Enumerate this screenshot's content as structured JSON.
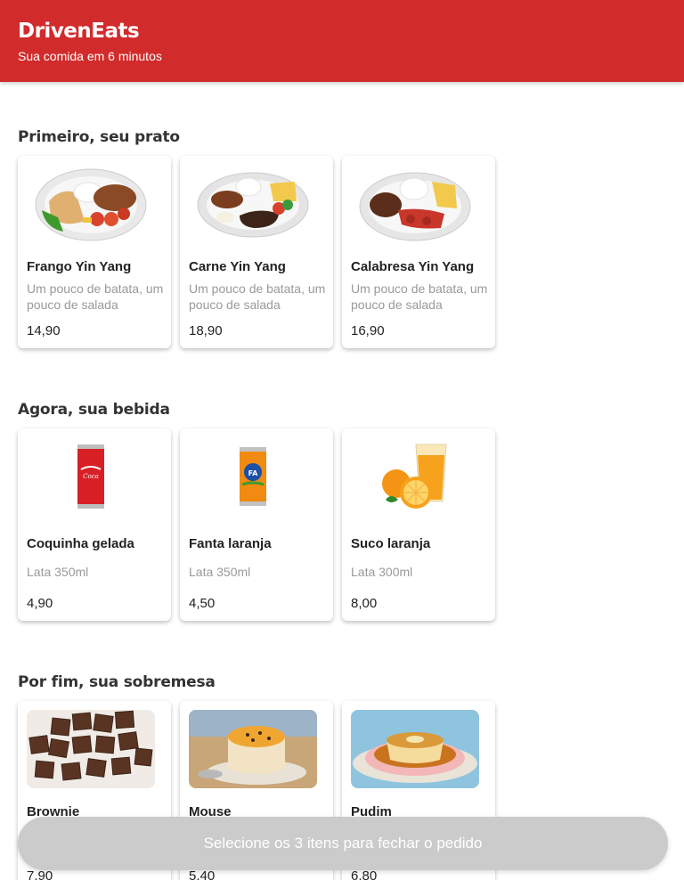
{
  "header": {
    "title": "DrivenEats",
    "subtitle": "Sua comida em 6 minutos"
  },
  "sections": [
    {
      "title": "Primeiro, seu prato",
      "items": [
        {
          "name": "Frango Yin Yang",
          "desc": "Um pouco de batata, um pouco de salada",
          "price": "14,90",
          "image": "chicken-plate-image"
        },
        {
          "name": "Carne Yin Yang",
          "desc": "Um pouco de batata, um pouco de salada",
          "price": "18,90",
          "image": "beef-plate-image"
        },
        {
          "name": "Calabresa Yin Yang",
          "desc": "Um pouco de batata, um pouco de salada",
          "price": "16,90",
          "image": "sausage-plate-image"
        }
      ]
    },
    {
      "title": "Agora, sua bebida",
      "items": [
        {
          "name": "Coquinha gelada",
          "desc": "Lata 350ml",
          "price": "4,90",
          "image": "coca-cola-can-image"
        },
        {
          "name": "Fanta laranja",
          "desc": "Lata 350ml",
          "price": "4,50",
          "image": "fanta-can-image"
        },
        {
          "name": "Suco laranja",
          "desc": "Lata 300ml",
          "price": "8,00",
          "image": "orange-juice-image"
        }
      ]
    },
    {
      "title": "Por fim, sua sobremesa",
      "items": [
        {
          "name": "Brownie",
          "desc": "",
          "price": "7,90",
          "image": "brownie-image"
        },
        {
          "name": "Mouse",
          "desc": "",
          "price": "5,40",
          "image": "mousse-image"
        },
        {
          "name": "Pudim",
          "desc": "",
          "price": "6,80",
          "image": "pudding-image"
        }
      ]
    }
  ],
  "footer": {
    "button_label": "Selecione os 3 itens para fechar o pedido"
  },
  "colors": {
    "brand": "#d12b2b",
    "button_disabled": "#cbcbcb"
  }
}
